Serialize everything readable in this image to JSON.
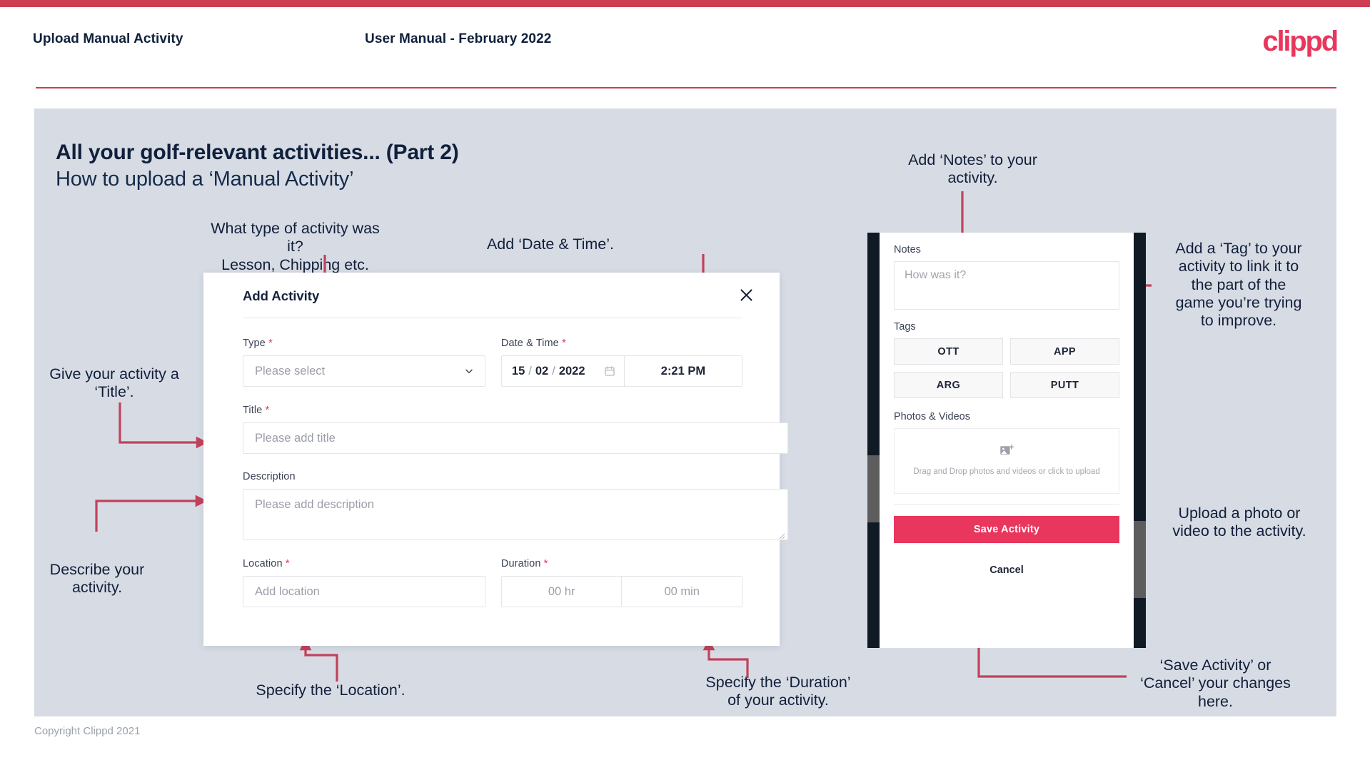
{
  "header": {
    "title": "Upload Manual Activity",
    "subtitle": "User Manual - February 2022",
    "brand": "clippd"
  },
  "slide": {
    "title": "All your golf-relevant activities... (Part 2)",
    "subtitle": "How to upload a ‘Manual Activity’"
  },
  "annotations": {
    "type": "What type of activity was it?\nLesson, Chipping etc.",
    "datetime": "Add ‘Date & Time’.",
    "title_field": "Give your activity a\n‘Title’.",
    "description": "Describe your\nactivity.",
    "location": "Specify the ‘Location’.",
    "duration": "Specify the ‘Duration’\nof your activity.",
    "notes": "Add ‘Notes’ to your\nactivity.",
    "tags": "Add a ‘Tag’ to your\nactivity to link it to\nthe part of the\ngame you’re trying\nto improve.",
    "photos": "Upload a photo or\nvideo to the activity.",
    "save_cancel": "‘Save Activity’ or\n‘Cancel’ your changes\nhere."
  },
  "dialog": {
    "title": "Add Activity",
    "close_icon": "close-icon",
    "fields": {
      "type": {
        "label": "Type",
        "required": "*",
        "placeholder": "Please select",
        "icon": "chevron-down-icon"
      },
      "datetime": {
        "label": "Date & Time",
        "required": "*",
        "day": "15",
        "month": "02",
        "year": "2022",
        "separator": "/",
        "time": "2:21 PM",
        "icon": "calendar-icon"
      },
      "title": {
        "label": "Title",
        "required": "*",
        "placeholder": "Please add title"
      },
      "description": {
        "label": "Description",
        "required": "",
        "placeholder": "Please add description"
      },
      "location": {
        "label": "Location",
        "required": "*",
        "placeholder": "Add location"
      },
      "duration": {
        "label": "Duration",
        "required": "*",
        "hours_placeholder": "00 hr",
        "minutes_placeholder": "00 min"
      }
    }
  },
  "phone": {
    "notes": {
      "label": "Notes",
      "placeholder": "How was it?"
    },
    "tags": {
      "label": "Tags",
      "items": [
        "OTT",
        "APP",
        "ARG",
        "PUTT"
      ]
    },
    "photos": {
      "label": "Photos & Videos",
      "icon": "add-image-icon",
      "drop_text": "Drag and Drop photos and videos or click to upload"
    },
    "save_label": "Save Activity",
    "cancel_label": "Cancel"
  },
  "footer": {
    "copyright": "Copyright Clippd 2021"
  },
  "colors": {
    "brand_pink": "#e8365d",
    "top_bar": "#ce3c54",
    "slide_bg": "#d7dce4",
    "connector": "#c2415c",
    "text_dark": "#10203c"
  }
}
